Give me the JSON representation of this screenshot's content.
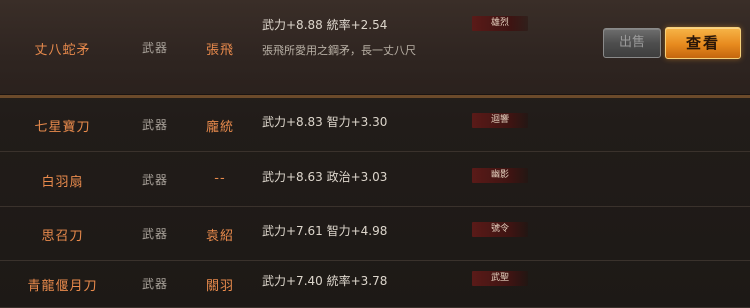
{
  "weapons": [
    {
      "name": "丈八蛇矛",
      "type": "武器",
      "owner": "張飛",
      "stats": "武力+8.88  統率+2.54",
      "tag": "雄烈",
      "description": "張飛所愛用之鋼矛，長一丈八尺",
      "selected": true
    },
    {
      "name": "七星寶刀",
      "type": "武器",
      "owner": "龐統",
      "stats": "武力+8.83  智力+3.30",
      "tag": "迴響"
    },
    {
      "name": "白羽扇",
      "type": "武器",
      "owner": "--",
      "stats": "武力+8.63  政治+3.03",
      "tag": "幽影"
    },
    {
      "name": "思召刀",
      "type": "武器",
      "owner": "袁紹",
      "stats": "武力+7.61  智力+4.98",
      "tag": "號令"
    },
    {
      "name": "青龍偃月刀",
      "type": "武器",
      "owner": "關羽",
      "stats": "武力+7.40  統率+3.78",
      "tag": "武聖"
    }
  ],
  "actions": {
    "sell_label": "出售",
    "view_label": "查看"
  },
  "colors": {
    "accent": "#e88a4c",
    "primary_button": "#e78a1e",
    "tag_bg": "#5a1a18"
  }
}
